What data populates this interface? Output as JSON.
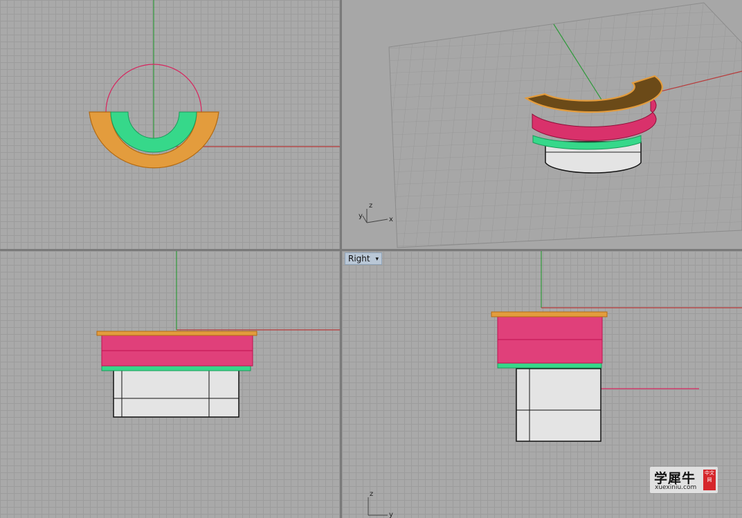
{
  "viewports": {
    "right_label": "Right",
    "axis": {
      "x": "x",
      "y": "y",
      "z": "z"
    }
  },
  "watermark": {
    "chinese": "学犀牛",
    "url": "xuexiniu.com",
    "badge": "中文网"
  },
  "colors": {
    "grid_bg": "#a9a9a9",
    "grid_line": "#9c9c9c",
    "x_axis": "#b83a3a",
    "y_axis": "#2f9a3b",
    "orange_ledge": "#e39c3d",
    "pink_band": "#e0407a",
    "green_ring": "#36d88a",
    "white_cylinder": "#e9e9e9"
  }
}
